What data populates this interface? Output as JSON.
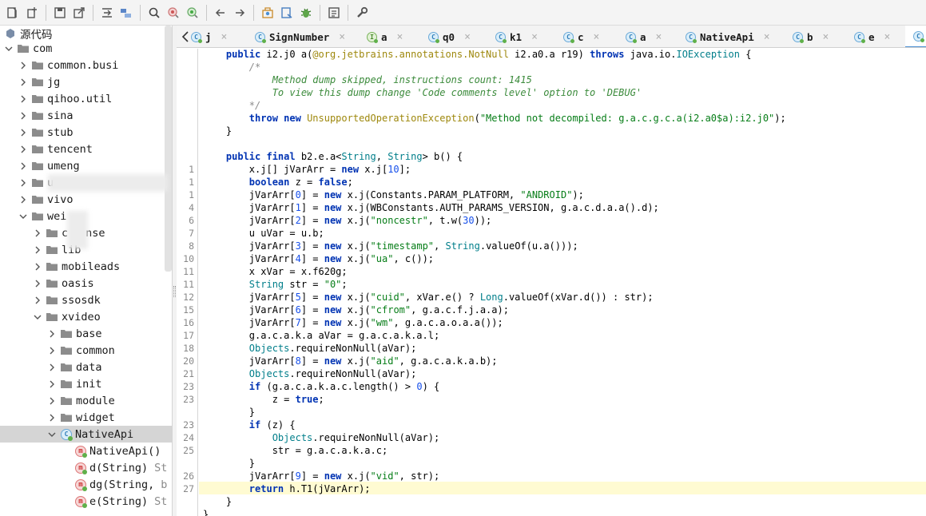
{
  "sidebar": {
    "root": "源代码",
    "items": [
      {
        "label": "com",
        "level": 0,
        "open": true
      },
      {
        "label": "common.busi",
        "level": 1
      },
      {
        "label": "jg",
        "level": 1
      },
      {
        "label": "qihoo.util",
        "level": 1
      },
      {
        "label": "sina",
        "level": 1
      },
      {
        "label": "stub",
        "level": 1
      },
      {
        "label": "tencent",
        "level": 1
      },
      {
        "label": "umeng",
        "level": 1
      },
      {
        "label": "u",
        "level": 1
      },
      {
        "label": "vivo",
        "level": 1
      },
      {
        "label": "wei",
        "level": 1,
        "open": true
      },
      {
        "label": "c",
        "suffix": "nse",
        "level": 2
      },
      {
        "label": "lib",
        "level": 2
      },
      {
        "label": "mobileads",
        "level": 2
      },
      {
        "label": "oasis",
        "level": 2
      },
      {
        "label": "ssosdk",
        "level": 2
      },
      {
        "label": "xvideo",
        "level": 2,
        "open": true
      },
      {
        "label": "base",
        "level": 3
      },
      {
        "label": "common",
        "level": 3
      },
      {
        "label": "data",
        "level": 3
      },
      {
        "label": "init",
        "level": 3
      },
      {
        "label": "module",
        "level": 3
      },
      {
        "label": "widget",
        "level": 3
      },
      {
        "label": "NativeApi",
        "level": 3,
        "kind": "class",
        "open": true,
        "selected": true
      },
      {
        "label": "NativeApi()",
        "level": 4,
        "kind": "method"
      },
      {
        "label": "d(String)",
        "extra": "St",
        "level": 4,
        "kind": "method"
      },
      {
        "label": "dg(String,",
        "extra": "b",
        "level": 4,
        "kind": "method"
      },
      {
        "label": "e(String)",
        "extra": "St",
        "level": 4,
        "kind": "method"
      }
    ]
  },
  "tabs": [
    {
      "label": "j",
      "icon": "class"
    },
    {
      "label": "SignNumber",
      "icon": "class"
    },
    {
      "label": "a",
      "icon": "interface"
    },
    {
      "label": "q0",
      "icon": "class"
    },
    {
      "label": "k1",
      "icon": "class"
    },
    {
      "label": "c",
      "icon": "class"
    },
    {
      "label": "a",
      "icon": "class"
    },
    {
      "label": "NativeApi",
      "icon": "class"
    },
    {
      "label": "b",
      "icon": "class"
    },
    {
      "label": "e",
      "icon": "class"
    },
    {
      "label": "",
      "icon": "class",
      "active": true
    }
  ],
  "code": {
    "lines": [
      {
        "n": "",
        "html": "    <span class=\"kw\">public</span> i2.j0 a(<span class=\"an\">@org.jetbrains.annotations.NotNull</span> i2.a0.a r19) <span class=\"kw\">throws</span> java.io.<span class=\"ty\">IOException</span> {"
      },
      {
        "n": "",
        "html": "        <span class=\"cmt\">/*</span>"
      },
      {
        "n": "",
        "html": "            <span class=\"cmt-g\">Method dump skipped, instructions count: 1415</span>"
      },
      {
        "n": "",
        "html": "            <span class=\"cmt-g\">To view this dump change 'Code comments level' option to 'DEBUG'</span>"
      },
      {
        "n": "",
        "html": "        <span class=\"cmt\">*/</span>"
      },
      {
        "n": "",
        "html": "        <span class=\"kw\">throw new</span> <span class=\"an\">UnsupportedOperationException</span>(<span class=\"str\">\"Method not decompiled: g.a.c.g.c.a(i2.a0$a):i2.j0\"</span>);"
      },
      {
        "n": "",
        "html": "    }"
      },
      {
        "n": "",
        "html": ""
      },
      {
        "n": "",
        "html": "    <span class=\"kw\">public final</span> b2.e.a&lt;<span class=\"ty\">String</span>, <span class=\"ty\">String</span>&gt; b() {"
      },
      {
        "n": "1",
        "html": "        x.j[] jVarArr = <span class=\"kw\">new</span> x.j[<span class=\"num\">10</span>];"
      },
      {
        "n": "1",
        "html": "        <span class=\"kw\">boolean</span> z = <span class=\"kw\">false</span>;"
      },
      {
        "n": "1",
        "html": "        jVarArr[<span class=\"num\">0</span>] = <span class=\"kw\">new</span> x.j(Constants.PARAM_PLATFORM, <span class=\"str\">\"ANDROID\"</span>);"
      },
      {
        "n": "4",
        "html": "        jVarArr[<span class=\"num\">1</span>] = <span class=\"kw\">new</span> x.j(WBConstants.AUTH_PARAMS_VERSION, g.a.c.d.a.a().d);"
      },
      {
        "n": "6",
        "html": "        jVarArr[<span class=\"num\">2</span>] = <span class=\"kw\">new</span> x.j(<span class=\"str\">\"noncestr\"</span>, t.w(<span class=\"num\">30</span>));"
      },
      {
        "n": "7",
        "html": "        u uVar = u.b;"
      },
      {
        "n": "8",
        "html": "        jVarArr[<span class=\"num\">3</span>] = <span class=\"kw\">new</span> x.j(<span class=\"str\">\"timestamp\"</span>, <span class=\"ty\">String</span>.valueOf(u.a()));"
      },
      {
        "n": "10",
        "html": "        jVarArr[<span class=\"num\">4</span>] = <span class=\"kw\">new</span> x.j(<span class=\"str\">\"ua\"</span>, c());"
      },
      {
        "n": "11",
        "html": "        x xVar = x.f620g;"
      },
      {
        "n": "11",
        "html": "        <span class=\"ty\">String</span> str = <span class=\"str\">\"0\"</span>;"
      },
      {
        "n": "12",
        "html": "        jVarArr[<span class=\"num\">5</span>] = <span class=\"kw\">new</span> x.j(<span class=\"str\">\"cuid\"</span>, xVar.e() ? <span class=\"ty\">Long</span>.valueOf(xVar.d()) : str);"
      },
      {
        "n": "15",
        "html": "        jVarArr[<span class=\"num\">6</span>] = <span class=\"kw\">new</span> x.j(<span class=\"str\">\"cfrom\"</span>, g.a.c.f.j.a.a);"
      },
      {
        "n": "16",
        "html": "        jVarArr[<span class=\"num\">7</span>] = <span class=\"kw\">new</span> x.j(<span class=\"str\">\"wm\"</span>, g.a.c.a.o.a.a());"
      },
      {
        "n": "17",
        "html": "        g.a.c.a.k.a aVar = g.a.c.a.k.a.l;"
      },
      {
        "n": "18",
        "html": "        <span class=\"ty\">Objects</span>.requireNonNull(aVar);"
      },
      {
        "n": "20",
        "html": "        jVarArr[<span class=\"num\">8</span>] = <span class=\"kw\">new</span> x.j(<span class=\"str\">\"aid\"</span>, g.a.c.a.k.a.b);"
      },
      {
        "n": "21",
        "html": "        <span class=\"ty\">Objects</span>.requireNonNull(aVar);"
      },
      {
        "n": "23",
        "html": "        <span class=\"kw\">if</span> (g.a.c.a.k.a.c.length() &gt; <span class=\"num\">0</span>) {"
      },
      {
        "n": "23",
        "html": "            z = <span class=\"kw\">true</span>;"
      },
      {
        "n": "",
        "html": "        }"
      },
      {
        "n": "23",
        "html": "        <span class=\"kw\">if</span> (z) {"
      },
      {
        "n": "24",
        "html": "            <span class=\"ty\">Objects</span>.requireNonNull(aVar);"
      },
      {
        "n": "25",
        "html": "            str = g.a.c.a.k.a.c;"
      },
      {
        "n": "",
        "html": "        }"
      },
      {
        "n": "26",
        "html": "        jVarArr[<span class=\"num\">9</span>] = <span class=\"kw\">new</span> x.j(<span class=\"str\">\"vid\"</span>, str);"
      },
      {
        "n": "27",
        "html": "        <span class=\"kw\">return</span> h.T1(jVarArr);"
      },
      {
        "n": "",
        "html": "    }"
      },
      {
        "n": "",
        "html": "}"
      }
    ]
  },
  "colors": {
    "keyword": "#0033b3",
    "string": "#067d17",
    "comment": "#3c8b3c",
    "highlight": "#fffbd2",
    "selection": "#d5d5d5"
  }
}
